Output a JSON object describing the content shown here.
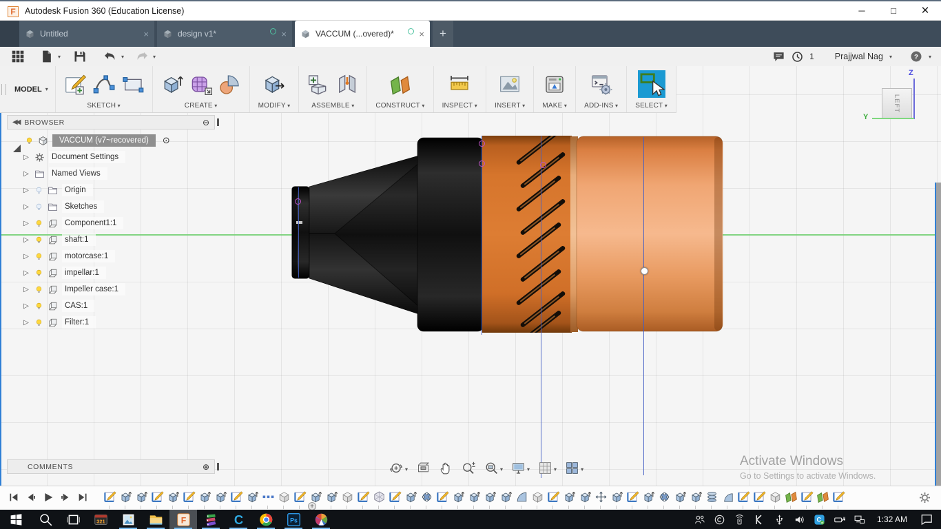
{
  "window": {
    "title": "Autodesk Fusion 360 (Education License)",
    "controls": [
      "minimize",
      "maximize",
      "close"
    ]
  },
  "tabs": {
    "items": [
      {
        "label": "Untitled",
        "active": false,
        "cloud": false
      },
      {
        "label": "design v1*",
        "active": false,
        "cloud": true
      },
      {
        "label": "VACCUM (...overed)*",
        "active": true,
        "cloud": true
      }
    ],
    "new_tab_icon": "plus"
  },
  "qat": {
    "left_icons": [
      "app-grid",
      "file",
      "save",
      "undo",
      "redo"
    ],
    "right": {
      "comment_icon": "comment",
      "clock_icon": "clock",
      "notification_count": "1",
      "user": "Prajjwal Nag",
      "help_icon": "help"
    }
  },
  "ribbon": {
    "workspace": "MODEL",
    "groups": [
      {
        "label": "SKETCH",
        "icons": [
          "create-sketch",
          "spline",
          "rectangle"
        ],
        "selected": false
      },
      {
        "label": "CREATE",
        "icons": [
          "extrude",
          "form",
          "sweep"
        ],
        "selected": false
      },
      {
        "label": "MODIFY",
        "icons": [
          "press-pull"
        ],
        "selected": false
      },
      {
        "label": "ASSEMBLE",
        "icons": [
          "new-component",
          "joint"
        ],
        "selected": false
      },
      {
        "label": "CONSTRUCT",
        "icons": [
          "construction-plane"
        ],
        "selected": false
      },
      {
        "label": "INSPECT",
        "icons": [
          "measure"
        ],
        "selected": false
      },
      {
        "label": "INSERT",
        "icons": [
          "insert-image"
        ],
        "selected": false
      },
      {
        "label": "MAKE",
        "icons": [
          "3d-print"
        ],
        "selected": false
      },
      {
        "label": "ADD-INS",
        "icons": [
          "scripts-addins"
        ],
        "selected": false
      },
      {
        "label": "SELECT",
        "icons": [
          "select"
        ],
        "selected": true
      }
    ]
  },
  "browser": {
    "title": "BROWSER",
    "collapse_icon": "collapse-left",
    "minus_icon": "circle-minus",
    "root": {
      "label": "VACCUM (v7~recovered)",
      "bulb": "on",
      "icon": "assembly-cube",
      "selected": true,
      "radio_icon": "circle-dot"
    },
    "items": [
      {
        "label": "Document Settings",
        "icon": "gear",
        "bulb": "none"
      },
      {
        "label": "Named Views",
        "icon": "folder",
        "bulb": "none"
      },
      {
        "label": "Origin",
        "icon": "folder",
        "bulb": "off"
      },
      {
        "label": "Sketches",
        "icon": "folder",
        "bulb": "off"
      },
      {
        "label": "Component1:1",
        "icon": "component-cube",
        "bulb": "on"
      },
      {
        "label": "shaft:1",
        "icon": "component-cube",
        "bulb": "on"
      },
      {
        "label": "motorcase:1",
        "icon": "component-cube",
        "bulb": "on"
      },
      {
        "label": "impellar:1",
        "icon": "component-cube",
        "bulb": "on"
      },
      {
        "label": "Impeller case:1",
        "icon": "component-cube",
        "bulb": "on"
      },
      {
        "label": "CAS:1",
        "icon": "component-cube",
        "bulb": "on"
      },
      {
        "label": "Filter:1",
        "icon": "component-cube",
        "bulb": "on"
      }
    ]
  },
  "comments": {
    "title": "COMMENTS",
    "add_icon": "circle-plus"
  },
  "viewcube": {
    "face": "LEFT",
    "z_axis": "Z",
    "y_axis": "Y"
  },
  "navbar": {
    "items": [
      {
        "icon": "orbit",
        "caret": true
      },
      {
        "icon": "look-at",
        "caret": false
      },
      {
        "icon": "pan",
        "caret": false
      },
      {
        "icon": "zoom",
        "caret": false
      },
      {
        "icon": "fit",
        "caret": true
      },
      {
        "icon": "display-settings",
        "caret": true
      },
      {
        "icon": "grid-settings",
        "caret": true
      },
      {
        "icon": "viewports",
        "caret": true
      }
    ]
  },
  "timeline": {
    "playback": [
      "go-to-start",
      "step-back",
      "play",
      "step-forward",
      "go-to-end"
    ],
    "features": [
      "sketch",
      "extrude",
      "extrude",
      "sketch",
      "extrude",
      "sketch",
      "extrude",
      "extrude",
      "sketch",
      "extrude",
      "dots",
      "box",
      "sketch",
      "extrude",
      "extrude",
      "box",
      "sketch",
      "form",
      "sketch",
      "extrude",
      "joint",
      "sketch",
      "extrude",
      "extrude",
      "extrude",
      "extrude",
      "revolve",
      "box",
      "sketch",
      "extrude",
      "extrude",
      "move",
      "extrude",
      "sketch",
      "extrude",
      "joint",
      "extrude",
      "extrude",
      "coil",
      "fillet",
      "sketch",
      "sketch",
      "box",
      "plane",
      "sketch",
      "plane",
      "sketch"
    ],
    "settings_icon": "gear",
    "zoom_control_icon": "plus"
  },
  "watermark": {
    "line1": "Activate Windows",
    "line2": "Go to Settings to activate Windows."
  },
  "taskbar": {
    "apps": [
      {
        "icon": "start",
        "running": false,
        "active": false
      },
      {
        "icon": "search",
        "running": false,
        "active": false
      },
      {
        "icon": "task-view",
        "running": false,
        "active": false
      },
      {
        "icon": "media-player-classic",
        "running": false,
        "active": false
      },
      {
        "icon": "photos",
        "running": true,
        "active": false
      },
      {
        "icon": "file-explorer",
        "running": true,
        "active": false
      },
      {
        "icon": "fusion-360",
        "running": true,
        "active": true
      },
      {
        "icon": "winrar",
        "running": true,
        "active": false
      },
      {
        "icon": "ccleaner",
        "running": true,
        "active": false
      },
      {
        "icon": "chrome",
        "running": true,
        "active": false
      },
      {
        "icon": "photoshop",
        "running": true,
        "active": false
      },
      {
        "icon": "picasa",
        "running": true,
        "active": false
      }
    ],
    "tray_icons": [
      "people",
      "creative-cloud",
      "hotspot",
      "kaspersky",
      "usb",
      "volume",
      "ccleaner-monitor",
      "power",
      "network"
    ],
    "clock": "1:32 AM",
    "notification_icon": "action-center"
  },
  "colors": {
    "tabbar": "#3e4c5a",
    "select_highlight": "#1b9ad2",
    "model_vent_orange": "#d4742c",
    "model_case_orange": "#efa06b",
    "model_nozzle_black": "#141414",
    "axis_green": "#7fd87f",
    "construction_blue": "#425ec4",
    "taskbar_black": "#0f1216",
    "running_indicator": "#76b9ed"
  }
}
